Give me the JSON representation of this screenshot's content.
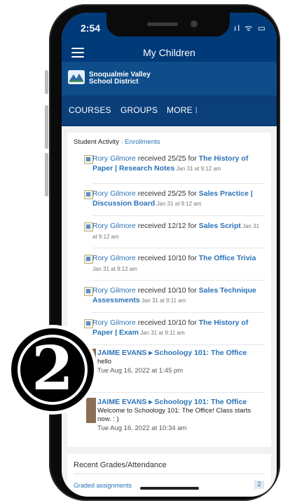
{
  "status": {
    "time": "2:54",
    "icons": "ıl ᯤ ▭"
  },
  "header": {
    "title": "My Children"
  },
  "district": {
    "name": "Snoqualmie Valley\nSchool District"
  },
  "nav": {
    "courses": "COURSES",
    "groups": "GROUPS",
    "more": "MORE ⁝"
  },
  "activity": {
    "label": "Student Activity",
    "separator": " · ",
    "link": "Enrollments",
    "items": [
      {
        "who": "Rory Gilmore",
        "verb": " received 25/25 for ",
        "course": "The History of Paper | Research Notes",
        "date": " Jan 31 at 9:12 am"
      },
      {
        "who": "Rory Gilmore",
        "verb": " received 25/25 for ",
        "course": "Sales Practice | Discussion Board",
        "date": " Jan 31 at 9:12 am"
      },
      {
        "who": "Rory Gilmore",
        "verb": " received 12/12 for ",
        "course": "Sales Script",
        "date": " Jan 31 at 9:12 am"
      },
      {
        "who": "Rory Gilmore",
        "verb": " received 10/10 for ",
        "course": "The Office Trivia",
        "date": " Jan 31 at 9:12 am"
      },
      {
        "who": "Rory Gilmore",
        "verb": " received 10/10 for ",
        "course": "Sales Technique Assessments",
        "date": " Jan 31 at 9:11 am"
      },
      {
        "who": "Rory Gilmore",
        "verb": " received 10/10 for ",
        "course": "The History of Paper | Exam",
        "date": " Jan 31 at 9:11 am"
      }
    ],
    "posts": [
      {
        "title": "JAIME EVANS ▸ Schoology 101: The Office",
        "body": "hello",
        "date": "Tue Aug 16, 2022 at 1:45 pm"
      },
      {
        "title": "JAIME EVANS ▸ Schoology 101: The Office",
        "body": "Welcome to Schoology 101: The Office!  Class starts now. : )",
        "date": "Tue Aug 16, 2022 at 10:34 am"
      }
    ]
  },
  "recent": {
    "title": "Recent Grades/Attendance",
    "row": "Graded assignments",
    "count": "2"
  },
  "badge": {
    "number": "2"
  },
  "colors": {
    "appbar": "#003a78",
    "link": "#2a72b8"
  }
}
